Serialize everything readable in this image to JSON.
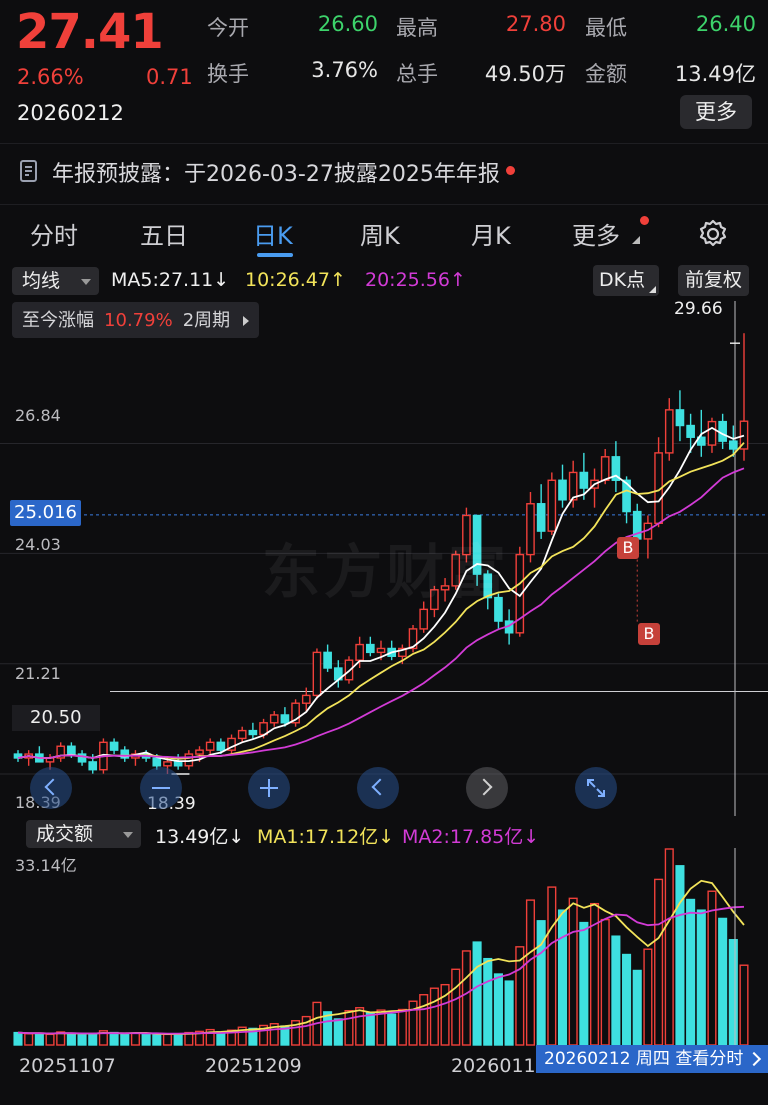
{
  "quote": {
    "price": "27.41",
    "change_pct": "2.66%",
    "change": "0.71",
    "date": "20260212",
    "fields": [
      {
        "label": "今开",
        "value": "26.60",
        "color": "#3dd36b"
      },
      {
        "label": "最高",
        "value": "27.80",
        "color": "#f0403a"
      },
      {
        "label": "最低",
        "value": "26.40",
        "color": "#3dd36b"
      },
      {
        "label": "换手",
        "value": "3.76%",
        "color": "#e6e6e6"
      },
      {
        "label": "总手",
        "value": "49.50万",
        "color": "#e6e6e6"
      },
      {
        "label": "金额",
        "value": "13.49亿",
        "color": "#e6e6e6"
      }
    ],
    "more_label": "更多"
  },
  "notice": {
    "icon": "document-icon",
    "text": "年报预披露：于2026-03-27披露2025年年报"
  },
  "tabs": [
    {
      "label": "分时",
      "active": false
    },
    {
      "label": "五日",
      "active": false
    },
    {
      "label": "日K",
      "active": true
    },
    {
      "label": "周K",
      "active": false
    },
    {
      "label": "月K",
      "active": false
    },
    {
      "label": "更多",
      "active": false
    }
  ],
  "settings_icon": "gear-icon",
  "kline": {
    "indicator_select": "均线",
    "ma5": "MA5:27.11↓",
    "ma10": "10:26.47↑",
    "ma20": "20:25.56↑",
    "dk_label": "DK点",
    "adjust_label": "前复权",
    "range_info": {
      "label": "至今涨幅",
      "value": "10.79%",
      "period": "2周期"
    },
    "y_labels": [
      "26.84",
      "24.03",
      "21.21",
      "18.39"
    ],
    "crosshair_price": "25.016",
    "level_price": "20.50",
    "max_label": "29.66",
    "min_label": "18.39",
    "watermark": "东方财富",
    "signal_labels": [
      "B",
      "B"
    ]
  },
  "volume": {
    "indicator_select": "成交额",
    "amount": "13.49亿↓",
    "ma1": "MA1:17.12亿↓",
    "ma2": "MA2:17.85亿↓",
    "y_max": "33.14亿"
  },
  "x_dates": [
    "20251107",
    "20251209",
    "2026011"
  ],
  "footer_badge": "20260212 周四  查看分时",
  "colors": {
    "up": "#f0403a",
    "down": "#3ee0e0",
    "ma5": "#ffffff",
    "ma10": "#f2e35a",
    "ma20": "#d23bd6"
  },
  "chart_data": {
    "type": "candlestick",
    "ohlc": [
      [
        18.9,
        19.0,
        18.7,
        18.8
      ],
      [
        18.8,
        19.0,
        18.6,
        18.9
      ],
      [
        18.9,
        19.1,
        18.7,
        18.7
      ],
      [
        18.7,
        18.9,
        18.5,
        18.8
      ],
      [
        18.8,
        19.2,
        18.7,
        19.1
      ],
      [
        19.1,
        19.2,
        18.8,
        18.9
      ],
      [
        18.9,
        19.0,
        18.6,
        18.7
      ],
      [
        18.7,
        18.9,
        18.4,
        18.5
      ],
      [
        18.5,
        19.3,
        18.4,
        19.2
      ],
      [
        19.2,
        19.3,
        18.9,
        19.0
      ],
      [
        19.0,
        19.1,
        18.7,
        18.8
      ],
      [
        18.8,
        19.0,
        18.6,
        18.9
      ],
      [
        18.9,
        19.0,
        18.7,
        18.8
      ],
      [
        18.8,
        18.9,
        18.5,
        18.6
      ],
      [
        18.6,
        18.8,
        18.39,
        18.7
      ],
      [
        18.7,
        18.9,
        18.5,
        18.6
      ],
      [
        18.6,
        19.0,
        18.5,
        18.9
      ],
      [
        18.9,
        19.1,
        18.7,
        19.0
      ],
      [
        19.0,
        19.3,
        18.9,
        19.2
      ],
      [
        19.2,
        19.3,
        18.9,
        19.0
      ],
      [
        19.0,
        19.4,
        18.9,
        19.3
      ],
      [
        19.3,
        19.6,
        19.2,
        19.5
      ],
      [
        19.5,
        19.7,
        19.3,
        19.4
      ],
      [
        19.4,
        19.8,
        19.3,
        19.7
      ],
      [
        19.7,
        20.0,
        19.6,
        19.9
      ],
      [
        19.9,
        20.1,
        19.6,
        19.7
      ],
      [
        19.7,
        20.3,
        19.6,
        20.2
      ],
      [
        20.2,
        20.6,
        20.0,
        20.4
      ],
      [
        20.4,
        21.6,
        20.3,
        21.5
      ],
      [
        21.5,
        21.7,
        21.0,
        21.1
      ],
      [
        21.1,
        21.3,
        20.6,
        20.8
      ],
      [
        20.8,
        21.4,
        20.7,
        21.3
      ],
      [
        21.3,
        21.9,
        21.1,
        21.7
      ],
      [
        21.7,
        21.9,
        21.4,
        21.5
      ],
      [
        21.5,
        21.8,
        21.3,
        21.6
      ],
      [
        21.6,
        21.8,
        21.3,
        21.4
      ],
      [
        21.4,
        21.7,
        21.2,
        21.6
      ],
      [
        21.6,
        22.2,
        21.5,
        22.1
      ],
      [
        22.1,
        22.8,
        22.0,
        22.6
      ],
      [
        22.6,
        23.2,
        22.4,
        23.1
      ],
      [
        23.1,
        23.4,
        22.8,
        23.2
      ],
      [
        23.2,
        24.1,
        23.1,
        24.0
      ],
      [
        24.0,
        25.2,
        23.8,
        25.0
      ],
      [
        25.0,
        24.8,
        23.2,
        23.5
      ],
      [
        23.5,
        23.6,
        22.6,
        22.9
      ],
      [
        22.9,
        23.0,
        22.1,
        22.3
      ],
      [
        22.3,
        22.6,
        21.7,
        22.0
      ],
      [
        22.0,
        24.2,
        21.9,
        24.0
      ],
      [
        24.0,
        25.6,
        23.8,
        25.3
      ],
      [
        25.3,
        25.8,
        24.4,
        24.6
      ],
      [
        24.6,
        26.1,
        24.5,
        25.9
      ],
      [
        25.9,
        26.3,
        25.2,
        25.4
      ],
      [
        25.4,
        26.4,
        25.2,
        26.1
      ],
      [
        26.1,
        26.6,
        25.4,
        25.7
      ],
      [
        25.7,
        26.2,
        25.2,
        25.9
      ],
      [
        25.9,
        26.7,
        25.8,
        26.5
      ],
      [
        26.5,
        26.9,
        25.6,
        25.9
      ],
      [
        25.9,
        26.0,
        24.8,
        25.1
      ],
      [
        25.1,
        25.3,
        24.2,
        24.4
      ],
      [
        24.4,
        25.0,
        23.9,
        24.8
      ],
      [
        24.8,
        27.0,
        24.7,
        26.6
      ],
      [
        26.6,
        28.0,
        26.4,
        27.7
      ],
      [
        27.7,
        28.2,
        26.9,
        27.3
      ],
      [
        27.3,
        27.6,
        26.6,
        27.0
      ],
      [
        27.0,
        27.7,
        26.5,
        26.8
      ],
      [
        26.8,
        27.5,
        26.6,
        27.4
      ],
      [
        27.4,
        27.6,
        26.7,
        26.9
      ],
      [
        26.9,
        27.3,
        26.5,
        26.7
      ],
      [
        26.7,
        29.66,
        26.4,
        27.41
      ]
    ],
    "amount": [
      2.1,
      1.9,
      2.0,
      1.8,
      2.2,
      2.0,
      1.7,
      1.9,
      2.4,
      2.1,
      1.8,
      2.0,
      1.9,
      1.7,
      1.8,
      1.9,
      2.1,
      2.3,
      2.6,
      2.2,
      2.5,
      3.0,
      2.8,
      3.3,
      3.6,
      3.2,
      4.1,
      4.8,
      7.2,
      5.6,
      4.4,
      5.8,
      6.3,
      5.5,
      5.9,
      5.2,
      6.0,
      7.4,
      8.5,
      9.6,
      10.2,
      12.8,
      15.9,
      17.4,
      14.6,
      12.0,
      10.8,
      16.6,
      24.5,
      21.0,
      26.7,
      22.8,
      24.8,
      20.7,
      23.9,
      21.2,
      18.4,
      15.3,
      12.6,
      16.2,
      28.0,
      33.14,
      30.3,
      24.6,
      22.8,
      26.0,
      21.4,
      17.8,
      13.49
    ],
    "ylim": [
      17.7,
      30.1
    ],
    "x_ticks": [
      "20251107",
      "20251209",
      "2026011"
    ]
  }
}
